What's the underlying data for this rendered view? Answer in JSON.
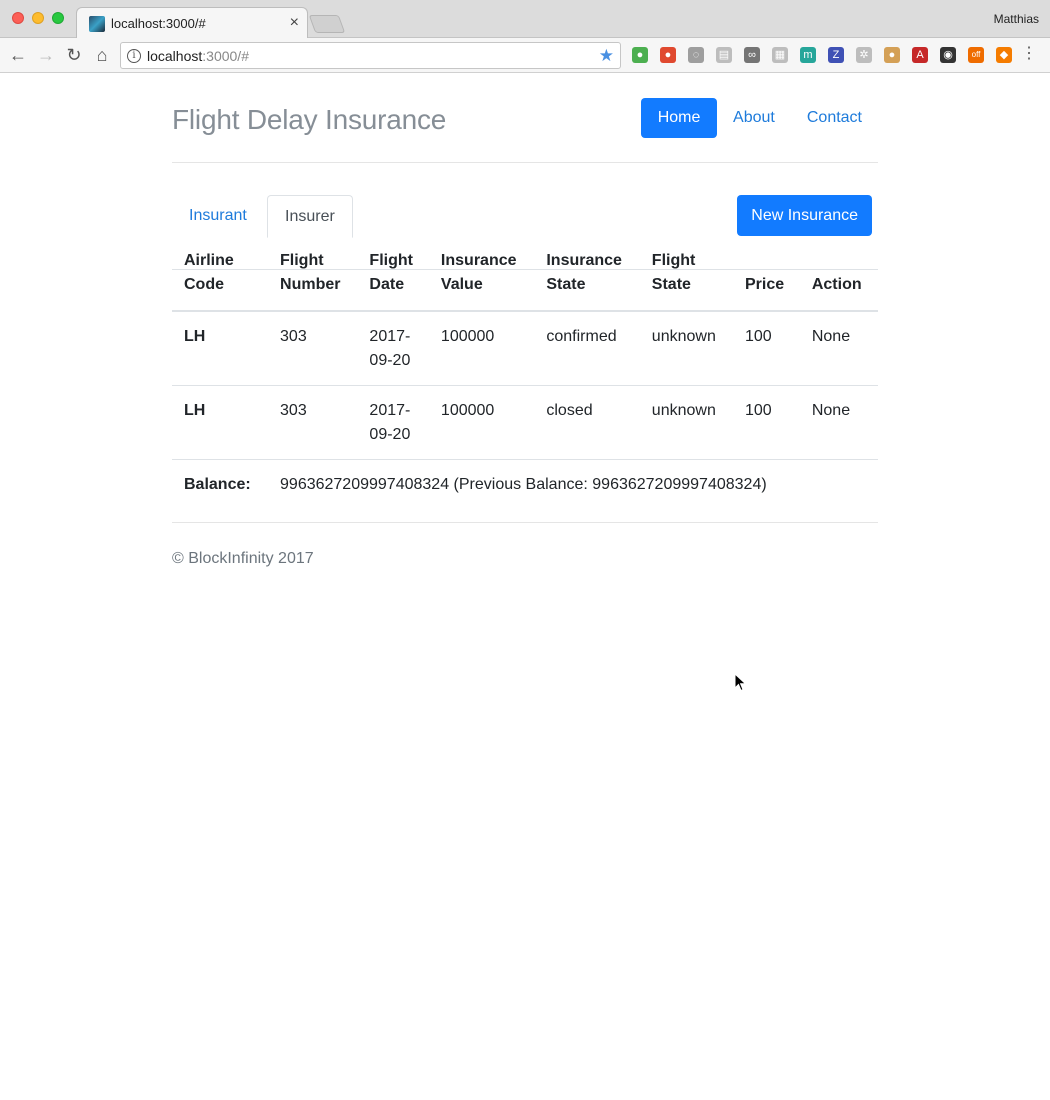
{
  "browser": {
    "tab_title": "localhost:3000/#",
    "tab_close": "×",
    "profile": "Matthias",
    "url_host": "localhost",
    "url_rest": ":3000/#",
    "info_icon": "i",
    "back": "←",
    "forward": "→",
    "reload": "↻",
    "home": "⌂",
    "star": "★",
    "menu": "⋮",
    "extensions": [
      {
        "name": "evernote-icon",
        "glyph": "●",
        "color": "#4caf50"
      },
      {
        "name": "chrome-ext-icon",
        "glyph": "●",
        "color": "#e0492f"
      },
      {
        "name": "eye-slash-icon",
        "glyph": "◌",
        "color": "#9e9e9e"
      },
      {
        "name": "reader-icon",
        "glyph": "▤",
        "color": "#bdbdbd"
      },
      {
        "name": "link-icon",
        "glyph": "∞",
        "color": "#757575"
      },
      {
        "name": "grid-icon",
        "glyph": "▦",
        "color": "#bdbdbd"
      },
      {
        "name": "m-icon",
        "glyph": "m",
        "color": "#26a69a"
      },
      {
        "name": "z-icon",
        "glyph": "Z",
        "color": "#3f51b5"
      },
      {
        "name": "gear-ext-icon",
        "glyph": "✲",
        "color": "#bdbdbd"
      },
      {
        "name": "cookie-icon",
        "glyph": "●",
        "color": "#d4a056"
      },
      {
        "name": "font-a-icon",
        "glyph": "A",
        "color": "#c62828"
      },
      {
        "name": "color-wheel-icon",
        "glyph": "◉",
        "color": "#333333"
      },
      {
        "name": "off-icon",
        "glyph": "off",
        "color": "#ef6c00"
      },
      {
        "name": "metamask-icon",
        "glyph": "◆",
        "color": "#f57c00"
      }
    ]
  },
  "header": {
    "brand": "Flight Delay Insurance",
    "nav": {
      "home": "Home",
      "about": "About",
      "contact": "Contact"
    }
  },
  "tabs": {
    "insurant": "Insurant",
    "insurer": "Insurer",
    "new_button": "New Insurance"
  },
  "table": {
    "headers": {
      "airline_code_1": "Airline",
      "airline_code_2": "Code",
      "flight_number_1": "Flight",
      "flight_number_2": "Number",
      "flight_date_1": "Flight",
      "flight_date_2": "Date",
      "insurance_value_1": "Insurance",
      "insurance_value_2": "Value",
      "insurance_state_1": "Insurance",
      "insurance_state_2": "State",
      "flight_state_1": "Flight",
      "flight_state_2": "State",
      "price": "Price",
      "action": "Action"
    },
    "rows": [
      {
        "airline_code": "LH",
        "flight_number": "303",
        "flight_date_1": "2017-",
        "flight_date_2": "09-20",
        "insurance_value": "100000",
        "insurance_state": "confirmed",
        "flight_state": "unknown",
        "price": "100",
        "action": "None"
      },
      {
        "airline_code": "LH",
        "flight_number": "303",
        "flight_date_1": "2017-",
        "flight_date_2": "09-20",
        "insurance_value": "100000",
        "insurance_state": "closed",
        "flight_state": "unknown",
        "price": "100",
        "action": "None"
      }
    ],
    "balance_label": "Balance:",
    "balance_value": "9963627209997408324 (Previous Balance: 9963627209997408324)"
  },
  "footer": {
    "copyright": "© BlockInfinity 2017"
  }
}
